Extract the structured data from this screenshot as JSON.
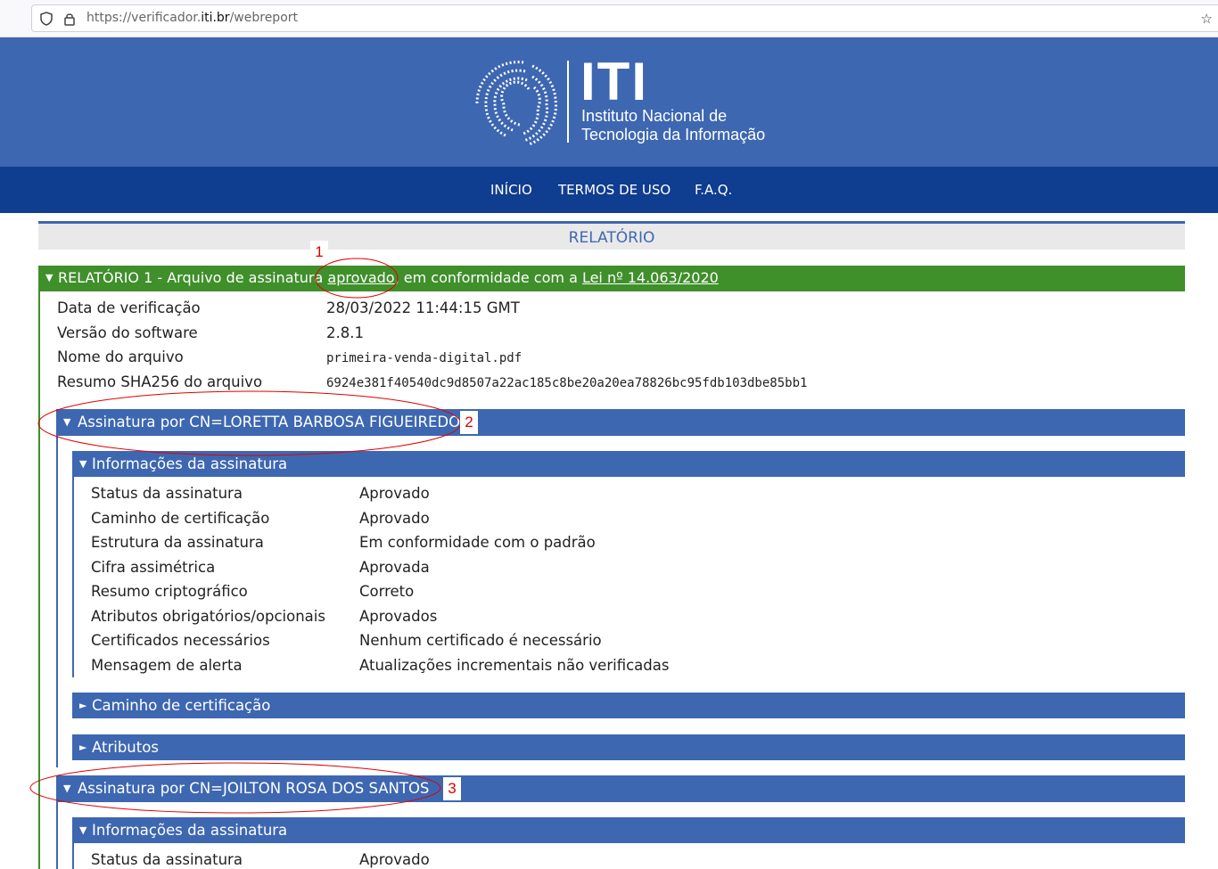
{
  "browser": {
    "url_prefix": "https://verificador.",
    "url_domain": "iti.br",
    "url_path": "/webreport"
  },
  "header": {
    "logo_word": "ITI",
    "logo_line1": "Instituto Nacional de",
    "logo_line2": "Tecnologia da Informação",
    "bg_color": "#3e67b1"
  },
  "nav": {
    "items": [
      "INÍCIO",
      "TERMOS DE USO",
      "F.A.Q."
    ],
    "bg_color": "#0f3d8f"
  },
  "report": {
    "section_title": "RELATÓRIO",
    "summary_prefix": "RELATÓRIO 1 - Arquivo de assinatura ",
    "summary_status": "aprovado",
    "summary_middle": ", em conformidade com a ",
    "summary_law": "Lei nº 14.063/2020",
    "status_color": "#3f8f2b",
    "details": [
      {
        "label": "Data de verificação",
        "value": "28/03/2022 11:44:15 GMT"
      },
      {
        "label": "Versão do software",
        "value": "2.8.1"
      },
      {
        "label": "Nome do arquivo",
        "value": "primeira-venda-digital.pdf"
      },
      {
        "label": "Resumo SHA256 do arquivo",
        "value": "6924e381f40540dc9d8507a22ac185c8be20a20ea78826bc95fdb103dbe85bb1"
      }
    ]
  },
  "signatures": [
    {
      "title": "Assinatura por CN=LORETTA BARBOSA FIGUEIREDO",
      "info_title": "Informações da assinatura",
      "info": [
        {
          "label": "Status da assinatura",
          "value": "Aprovado"
        },
        {
          "label": "Caminho de certificação",
          "value": "Aprovado"
        },
        {
          "label": "Estrutura da assinatura",
          "value": "Em conformidade com o padrão"
        },
        {
          "label": "Cifra assimétrica",
          "value": "Aprovada"
        },
        {
          "label": "Resumo criptográfico",
          "value": "Correto"
        },
        {
          "label": "Atributos obrigatórios/opcionais",
          "value": "Aprovados"
        },
        {
          "label": "Certificados necessários",
          "value": "Nenhum certificado é necessário"
        },
        {
          "label": "Mensagem de alerta",
          "value": "Atualizações incrementais não verificadas"
        }
      ],
      "cert_path_title": "Caminho de certificação",
      "attributes_title": "Atributos"
    },
    {
      "title": "Assinatura por CN=JOILTON ROSA DOS SANTOS",
      "info_title": "Informações da assinatura",
      "info": [
        {
          "label": "Status da assinatura",
          "value": "Aprovado"
        }
      ]
    }
  ],
  "annotations": {
    "marker1": "1",
    "marker2": "2",
    "marker3": "3",
    "color": "#e00000"
  }
}
